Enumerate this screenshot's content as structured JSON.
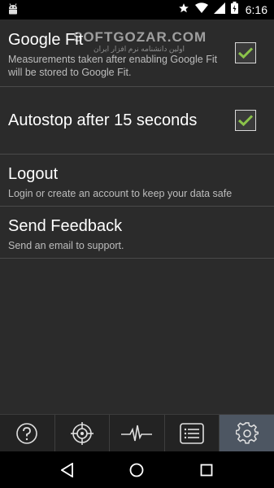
{
  "status_bar": {
    "time": "6:16",
    "icons": [
      "android-icon",
      "star-icon",
      "wifi-icon",
      "signal-icon",
      "battery-icon"
    ]
  },
  "watermark": {
    "text": "SOFTGOZAR.COM",
    "subtext": "اولین دانشنامه نرم افزار ایران"
  },
  "settings": [
    {
      "title": "Google Fit",
      "summary": "Measurements taken after enabling Google Fit will be stored to Google Fit.",
      "checked": true
    },
    {
      "title": "Autostop after 15 seconds",
      "summary": "",
      "checked": true
    },
    {
      "title": "Logout",
      "summary": "Login or create an account to keep your data safe"
    },
    {
      "title": "Send Feedback",
      "summary": "Send an email to support."
    }
  ],
  "tabs": [
    {
      "icon": "help-icon",
      "active": false
    },
    {
      "icon": "target-icon",
      "active": false
    },
    {
      "icon": "heartbeat-icon",
      "active": false
    },
    {
      "icon": "list-icon",
      "active": false
    },
    {
      "icon": "gear-icon",
      "active": true
    }
  ],
  "colors": {
    "background": "#2b2b2b",
    "divider": "#4a4a4a",
    "check_green": "#8bc34a",
    "active_tab": "#4d5662"
  }
}
